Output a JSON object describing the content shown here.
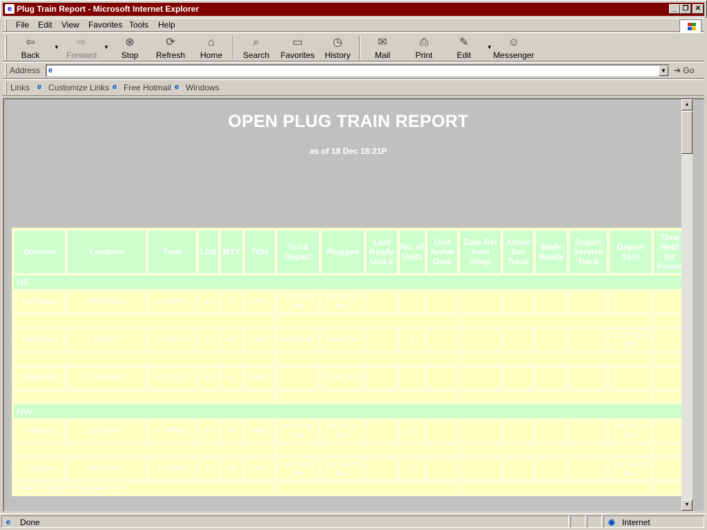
{
  "window": {
    "title": "Plug Train Report - Microsoft Internet Explorer",
    "controls": [
      "_",
      "❐",
      "✕"
    ]
  },
  "menu": [
    "File",
    "Edit",
    "View",
    "Favorites",
    "Tools",
    "Help"
  ],
  "toolbar": {
    "back": "Back",
    "forward": "Forward",
    "stop": "Stop",
    "refresh": "Refresh",
    "home": "Home",
    "search": "Search",
    "favorites": "Favorites",
    "history": "History",
    "mail": "Mail",
    "print": "Print",
    "edit": "Edit",
    "messenger": "Messenger"
  },
  "address": {
    "label": "Address",
    "value": "",
    "go": "Go"
  },
  "links": {
    "label": "Links",
    "items": [
      "Customize Links",
      "Free Hotmail",
      "Windows"
    ]
  },
  "report": {
    "title": "OPEN PLUG TRAIN REPORT",
    "subtitle": "as of 18 Dec 18:21P",
    "columns": [
      "Division",
      "Location",
      "Train",
      "LDS",
      "MTY",
      "TON",
      "Schd Depart",
      "Plugged",
      "Last Ready Unit #",
      "No. of Units",
      "Unit Arrive Date",
      "Date Rel from Shop",
      "Arrive Svc Track",
      "Made Ready",
      "Depart Service Track",
      "Depart Yard",
      "Time Held for Power"
    ],
    "divisions": [
      {
        "name": "NE",
        "rows": [
          {
            "cells": [
              "Harrisburg",
              "BUFFALO",
              "1-9WHT1",
              "31",
              "0",
              "2801",
              "15:00 18 Dec",
              "15:00 18 Dec",
              "",
              "",
              "",
              "",
              "",
              "",
              "",
              "",
              ""
            ]
          },
          {
            "cells": [
              "Harrisburg",
              "ERIE,E",
              "1-XG2-18",
              "2",
              "41",
              "1492",
              "08:00 18",
              "08:00 18",
              "",
              "1",
              "",
              "",
              "",
              "",
              "",
              "18:00 18 Dec",
              ""
            ]
          },
          {
            "cells": [
              "Pittsburgh",
              "CONWAY",
              "1-SC12-1",
              "43",
              "0",
              "3858",
              "",
              "15:00 18 1",
              "",
              "",
              "",
              "",
              "",
              "",
              "",
              "",
              ""
            ]
          }
        ]
      },
      {
        "name": "NW",
        "rows": [
          {
            "cells": [
              "Chicago",
              "ELKHART",
              "1-MP091",
              "29",
              "48",
              "4068",
              "09:30 18 Dec",
              "09:30 18 Dec",
              "",
              "2",
              "",
              "",
              "",
              "",
              "",
              "09:30 18 Dec",
              ""
            ]
          },
          {
            "cells": [
              "Chicago",
              "ELKHART",
              "1-EB4C5",
              "6",
              "58",
              "3817",
              "10:00 18 Dec",
              "10:00 18 Dec",
              "",
              "3",
              "",
              "",
              "",
              "",
              "",
              "18:00 18 Dec",
              ""
            ],
            "note": "Power changed at Beardstown 1502"
          }
        ]
      }
    ]
  },
  "status": {
    "text": "Done",
    "zone": "Internet"
  }
}
